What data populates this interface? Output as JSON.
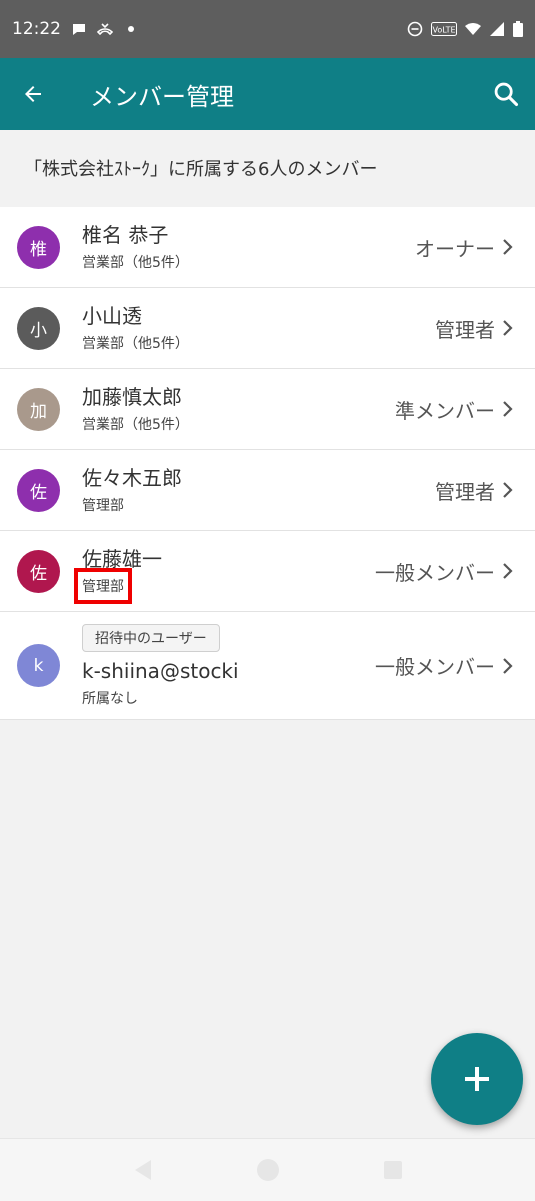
{
  "status_bar": {
    "time": "12:22"
  },
  "app_bar": {
    "title": "メンバー管理"
  },
  "subheader": {
    "text": "「株式会社ｽﾄｰｸ」に所属する6人のメンバー"
  },
  "members": [
    {
      "avatar": "椎",
      "avatar_color": "#8e2fad",
      "name": "椎名 恭子",
      "dept": "営業部（他5件）",
      "role": "オーナー"
    },
    {
      "avatar": "小",
      "avatar_color": "#5b5b5b",
      "name": "小山透",
      "dept": "営業部（他5件）",
      "role": "管理者"
    },
    {
      "avatar": "加",
      "avatar_color": "#a9998c",
      "name": "加藤慎太郎",
      "dept": "営業部（他5件）",
      "role": "準メンバー"
    },
    {
      "avatar": "佐",
      "avatar_color": "#8e2fad",
      "name": "佐々木五郎",
      "dept": "管理部",
      "role": "管理者"
    },
    {
      "avatar": "佐",
      "avatar_color": "#b0174e",
      "name": "佐藤雄一",
      "dept": "管理部",
      "role": "一般メンバー"
    }
  ],
  "invited": {
    "badge": "招待中のユーザー",
    "avatar": "k",
    "avatar_color": "#7f87d6",
    "email": "k-shiina@stocki",
    "dept": "所属なし",
    "role": "一般メンバー"
  },
  "colors": {
    "primary": "#0f7f86",
    "highlight": "#ef0000"
  }
}
